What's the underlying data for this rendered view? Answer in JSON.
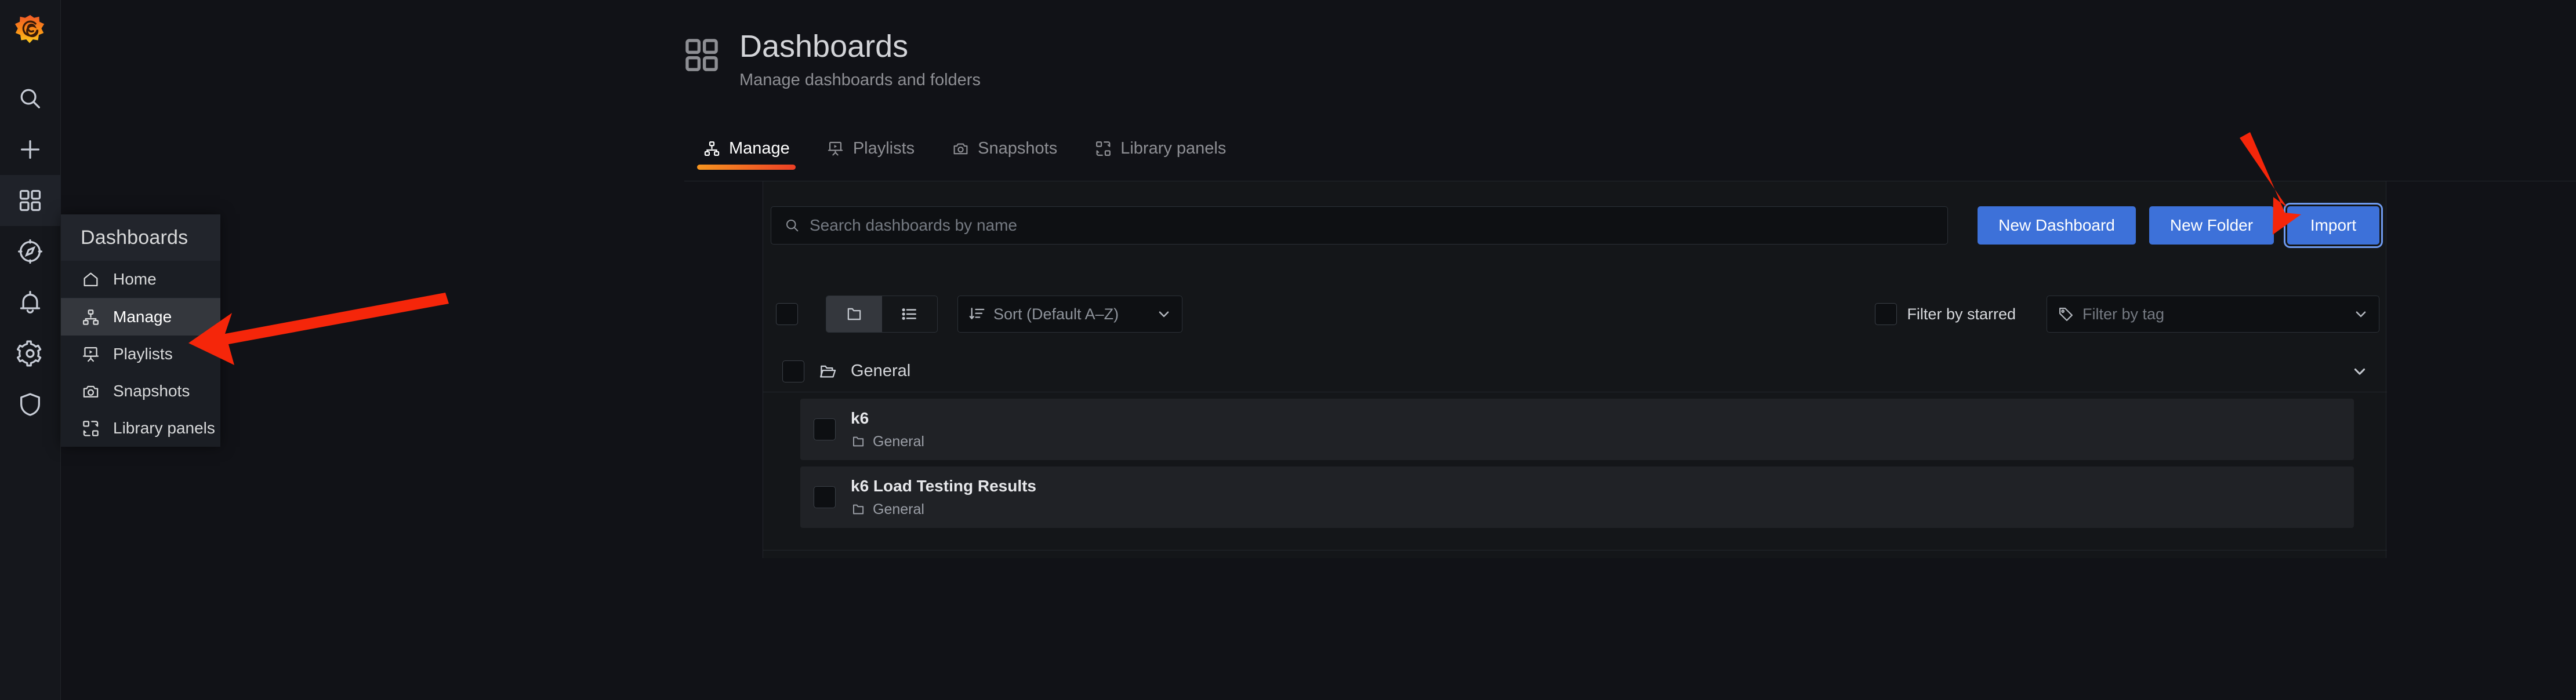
{
  "brand": {
    "logo": "grafana-logo"
  },
  "rail": {
    "items": [
      {
        "name": "dashboards",
        "icon": "apps-grid-icon",
        "active": true
      },
      {
        "name": "explore",
        "icon": "compass-icon",
        "active": false
      },
      {
        "name": "alerting",
        "icon": "bell-icon",
        "active": false
      },
      {
        "name": "configuration",
        "icon": "gear-icon",
        "active": false
      },
      {
        "name": "server-admin",
        "icon": "shield-icon",
        "active": false
      }
    ]
  },
  "mega_menu": {
    "title": "Dashboards",
    "items": [
      {
        "label": "Home",
        "icon": "home-icon",
        "selected": false
      },
      {
        "label": "Manage",
        "icon": "sitemap-icon",
        "selected": true
      },
      {
        "label": "Playlists",
        "icon": "presentation-play-icon",
        "selected": false
      },
      {
        "label": "Snapshots",
        "icon": "camera-icon",
        "selected": false
      },
      {
        "label": "Library panels",
        "icon": "library-panel-icon",
        "selected": false
      }
    ]
  },
  "header": {
    "icon": "apps-grid-icon",
    "title": "Dashboards",
    "subtitle": "Manage dashboards and folders"
  },
  "tabs": [
    {
      "label": "Manage",
      "icon": "sitemap-icon",
      "active": true
    },
    {
      "label": "Playlists",
      "icon": "presentation-play-icon",
      "active": false
    },
    {
      "label": "Snapshots",
      "icon": "camera-icon",
      "active": false
    },
    {
      "label": "Library panels",
      "icon": "library-panel-icon",
      "active": false
    }
  ],
  "search": {
    "placeholder": "Search dashboards by name",
    "value": "",
    "icon": "search-icon"
  },
  "actions": {
    "new_dashboard": "New Dashboard",
    "new_folder": "New Folder",
    "import": "Import",
    "accent_color": "#3d71d9"
  },
  "filters": {
    "select_all_checked": false,
    "view_folder_icon": "folder-icon",
    "view_list_icon": "list-icon",
    "view_mode": "folder",
    "sort": {
      "icon": "sort-amount-down-icon",
      "label": "Sort (Default A–Z)",
      "chevron": "chevron-down-icon"
    },
    "starred": {
      "label": "Filter by starred",
      "checked": false
    },
    "tag": {
      "icon": "tag-icon",
      "placeholder": "Filter by tag",
      "chevron": "chevron-down-icon"
    }
  },
  "results": {
    "folder": {
      "name": "General",
      "icon": "folder-open-icon",
      "chevron": "chevron-down-icon",
      "checked": false,
      "expanded": true
    },
    "dashboards": [
      {
        "title": "k6",
        "folder": "General",
        "folder_icon": "folder-icon",
        "checked": false
      },
      {
        "title": "k6 Load Testing Results",
        "folder": "General",
        "folder_icon": "folder-icon",
        "checked": false
      }
    ]
  },
  "annotations": {
    "color": "#f5260a",
    "arrows": [
      {
        "name": "arrow-to-manage",
        "points_to": "Manage"
      },
      {
        "name": "arrow-to-import",
        "points_to": "Import"
      }
    ]
  }
}
